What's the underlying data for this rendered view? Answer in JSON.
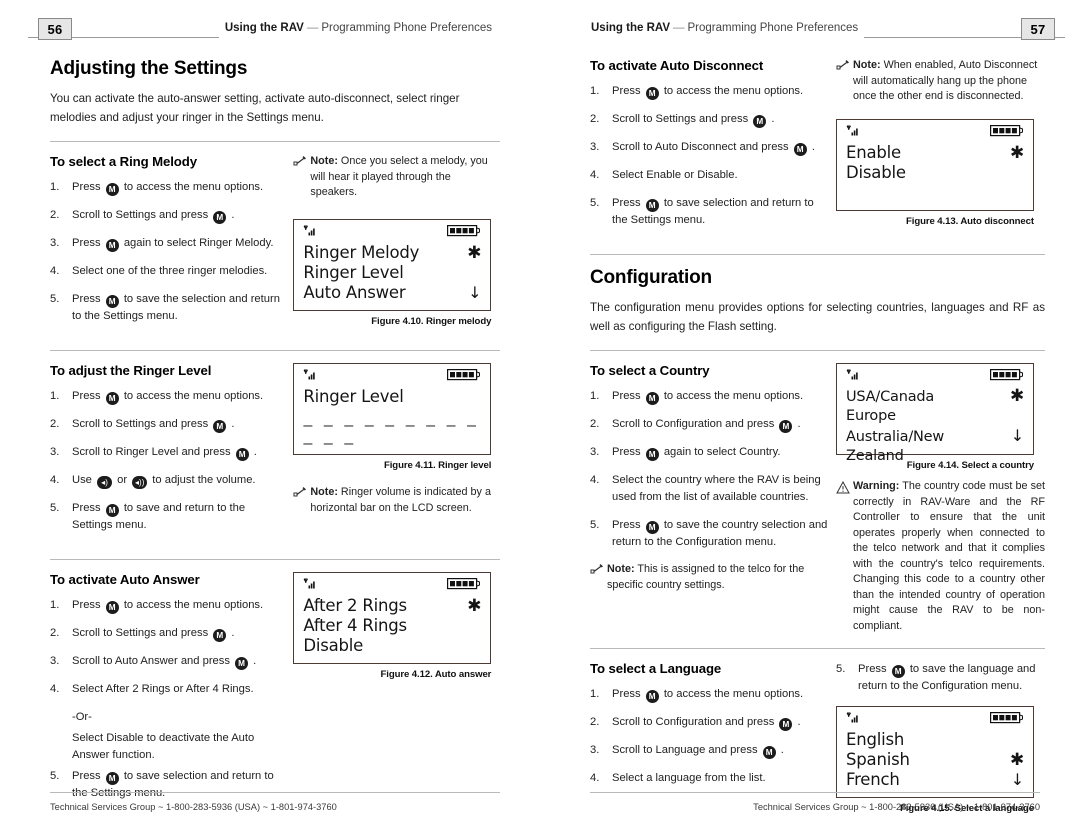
{
  "document": {
    "header_title_bold": "Using the RAV",
    "header_title_rest": "Programming Phone Preferences",
    "footer_text": "Technical Services Group ~ 1-800-283-5936 (USA) ~ 1-801-974-3760"
  },
  "left_page": {
    "page_number": "56",
    "section_title": "Adjusting the Settings",
    "intro": "You can activate the auto-answer setting, activate auto-disconnect, select ringer melodies and adjust your ringer in the Settings menu.",
    "ring_melody": {
      "heading": "To select a Ring Melody",
      "steps": [
        {
          "num": "1.",
          "pre": "Press",
          "btn": "M",
          "post": "to access the menu options."
        },
        {
          "num": "2.",
          "pre": "Scroll to Settings and press",
          "btn": "M",
          "post": "."
        },
        {
          "num": "3.",
          "pre": "Press",
          "btn": "M",
          "post": "again to select Ringer Melody."
        },
        {
          "num": "4.",
          "pre": "Select one of the three ringer melodies.",
          "btn": "",
          "post": ""
        },
        {
          "num": "5.",
          "pre": "Press",
          "btn": "M",
          "post": "to save the selection and return to the Settings menu."
        }
      ],
      "note_label": "Note:",
      "note_text": "Once you select a melody, you will hear it played through the speakers.",
      "lcd_rows": [
        {
          "text": "Ringer Melody",
          "mark": "✱"
        },
        {
          "text": "Ringer Level",
          "mark": ""
        },
        {
          "text": "Auto Answer",
          "mark": "↓"
        }
      ],
      "figure_caption": "Figure 4.10. Ringer melody"
    },
    "ringer_level": {
      "heading": "To adjust the Ringer Level",
      "steps": [
        {
          "num": "1.",
          "pre": "Press",
          "btn": "M",
          "post": "to access the menu options."
        },
        {
          "num": "2.",
          "pre": "Scroll to Settings and press",
          "btn": "M",
          "post": "."
        },
        {
          "num": "3.",
          "pre": "Scroll to Ringer Level and press",
          "btn": "M",
          "post": "."
        },
        {
          "num": "4.",
          "pre": "Use",
          "btn": "VOLPAIR",
          "post": "to adjust the volume."
        },
        {
          "num": "5.",
          "pre": "Press",
          "btn": "M",
          "post": "to save and return to the Settings menu."
        }
      ],
      "use_or": "or",
      "lcd_title": "Ringer Level",
      "lcd_bar": "– – – – – – – – – – – –",
      "figure_caption": "Figure 4.11. Ringer level",
      "note_label": "Note:",
      "note_text": "Ringer volume is indicated by a horizontal bar on the LCD screen."
    },
    "auto_answer": {
      "heading": "To activate Auto Answer",
      "steps": [
        {
          "num": "1.",
          "pre": "Press",
          "btn": "M",
          "post": "to access the menu options."
        },
        {
          "num": "2.",
          "pre": "Scroll to Settings and press",
          "btn": "M",
          "post": "."
        },
        {
          "num": "3.",
          "pre": "Scroll to Auto Answer and press",
          "btn": "M",
          "post": "."
        },
        {
          "num": "4.",
          "pre": "Select After 2 Rings or After 4 Rings.",
          "btn": "",
          "post": ""
        },
        {
          "num": "",
          "pre": "-Or-",
          "btn": "",
          "post": ""
        },
        {
          "num": "",
          "pre": "Select Disable to deactivate the Auto Answer function.",
          "btn": "",
          "post": ""
        },
        {
          "num": "5.",
          "pre": "Press",
          "btn": "M",
          "post": "to save selection and return to the Settings menu."
        }
      ],
      "lcd_rows": [
        {
          "text": "After 2 Rings",
          "mark": "✱"
        },
        {
          "text": "After 4 Rings",
          "mark": ""
        },
        {
          "text": "Disable",
          "mark": ""
        }
      ],
      "figure_caption": "Figure 4.12. Auto answer"
    }
  },
  "right_page": {
    "page_number": "57",
    "auto_disconnect": {
      "heading": "To activate Auto Disconnect",
      "steps": [
        {
          "num": "1.",
          "pre": "Press",
          "btn": "M",
          "post": "to access the menu options."
        },
        {
          "num": "2.",
          "pre": "Scroll to Settings and press",
          "btn": "M",
          "post": "."
        },
        {
          "num": "3.",
          "pre": "Scroll to Auto Disconnect and press",
          "btn": "M",
          "post": "."
        },
        {
          "num": "4.",
          "pre": "Select Enable or Disable.",
          "btn": "",
          "post": ""
        },
        {
          "num": "5.",
          "pre": "Press",
          "btn": "M",
          "post": "to save selection and return to the Settings menu."
        }
      ],
      "note_label": "Note:",
      "note_text": "When enabled, Auto Disconnect will automatically hang up the phone once the other end is disconnected.",
      "lcd_rows": [
        {
          "text": "Enable",
          "mark": "✱"
        },
        {
          "text": "Disable",
          "mark": ""
        }
      ],
      "figure_caption": "Figure 4.13. Auto disconnect"
    },
    "configuration": {
      "section_title": "Configuration",
      "intro": "The configuration menu provides options for selecting countries, languages and RF as well as configuring the Flash setting."
    },
    "country": {
      "heading": "To select a Country",
      "steps": [
        {
          "num": "1.",
          "pre": "Press",
          "btn": "M",
          "post": "to access the menu options."
        },
        {
          "num": "2.",
          "pre": "Scroll to Configuration and press",
          "btn": "M",
          "post": "."
        },
        {
          "num": "3.",
          "pre": "Press",
          "btn": "M",
          "post": "again to select Country."
        },
        {
          "num": "4.",
          "pre": "Select the country where the RAV is being used from the list of available countries.",
          "btn": "",
          "post": ""
        },
        {
          "num": "5.",
          "pre": "Press",
          "btn": "M",
          "post": "to save the country selection and return to the Configuration menu."
        }
      ],
      "note_label": "Note:",
      "note_text": "This is assigned to the telco for the specific country settings.",
      "lcd_rows": [
        {
          "text": "USA/Canada",
          "mark": "✱"
        },
        {
          "text": "Europe",
          "mark": ""
        },
        {
          "text": "Australia/New Zealand",
          "mark": "↓"
        }
      ],
      "figure_caption": "Figure 4.14. Select a country",
      "warning_label": "Warning:",
      "warning_text": "The country code must be set correctly in RAV-Ware and the RF Controller to ensure that the unit operates properly when connected to the telco network and that it complies with the country's telco requirements. Changing this code to a country other than the intended country of operation might cause the RAV to be non-compliant."
    },
    "language": {
      "heading": "To select a Language",
      "steps": [
        {
          "num": "1.",
          "pre": "Press",
          "btn": "M",
          "post": "to access the menu options."
        },
        {
          "num": "2.",
          "pre": "Scroll to Configuration and press",
          "btn": "M",
          "post": "."
        },
        {
          "num": "3.",
          "pre": "Scroll to Language and press",
          "btn": "M",
          "post": "."
        },
        {
          "num": "4.",
          "pre": "Select a language from the list.",
          "btn": "",
          "post": ""
        }
      ],
      "step5": {
        "num": "5.",
        "pre": "Press",
        "btn": "M",
        "post": "to save the language and return to the Configuration menu."
      },
      "lcd_rows": [
        {
          "text": "English",
          "mark": ""
        },
        {
          "text": "Spanish",
          "mark": "✱"
        },
        {
          "text": "French",
          "mark": "↓"
        }
      ],
      "figure_caption": "Figure 4.15. Select a language"
    }
  },
  "icons": {
    "signal": "signal-bars-icon",
    "battery": "battery-full-icon",
    "note": "note-hand-icon",
    "warning": "warning-triangle-icon",
    "menu_button": "m-button-icon",
    "vol_down": "volume-down-icon",
    "vol_up": "volume-up-icon"
  },
  "colors": {
    "lcd_border": "#4b3b33",
    "rule": "#b9b9b9",
    "page_box_bg": "#e6e6e6",
    "text": "#1a1a1a"
  }
}
